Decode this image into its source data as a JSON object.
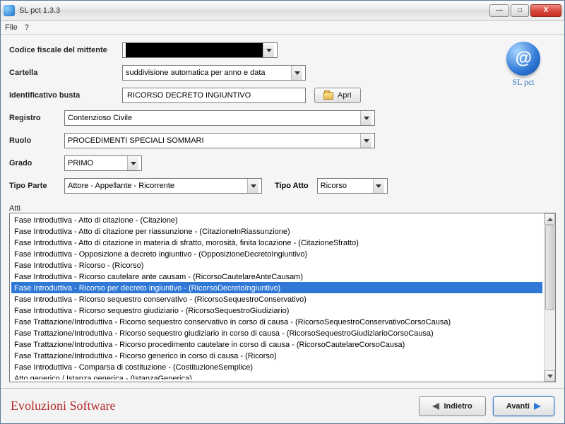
{
  "window": {
    "title": "SL pct 1.3.3"
  },
  "menubar": {
    "file": "File",
    "help": "?"
  },
  "labels": {
    "codice_fiscale": "Codice fiscale del mittente",
    "cartella": "Cartella",
    "identificativo": "Identificativo busta",
    "registro": "Registro",
    "ruolo": "Ruolo",
    "grado": "Grado",
    "tipo_parte": "Tipo Parte",
    "tipo_atto": "Tipo Atto",
    "atti": "Atti"
  },
  "values": {
    "cartella": "suddivisione automatica per anno e data",
    "identificativo": "RICORSO DECRETO INGIUNTIVO",
    "registro": "Contenzioso Civile",
    "ruolo": "PROCEDIMENTI SPECIALI SOMMARI",
    "grado": "PRIMO",
    "tipo_parte": "Attore - Appellante - Ricorrente",
    "tipo_atto": "Ricorso"
  },
  "buttons": {
    "apri": "Apri",
    "indietro": "Indietro",
    "avanti": "Avanti"
  },
  "logo_text": "SL pct",
  "selected_index": 6,
  "atti_list": [
    "Fase Introduttiva - Atto di citazione - (Citazione)",
    "Fase Introduttiva - Atto di citazione per riassunzione - (CitazioneInRiassunzione)",
    "Fase Introduttiva - Atto di citazione in materia di sfratto, morosità, finita locazione - (CitazioneSfratto)",
    "Fase Introduttiva - Opposizione a decreto ingiuntivo - (OpposizioneDecretoIngiuntivo)",
    "Fase Introduttiva - Ricorso - (Ricorso)",
    "Fase Introduttiva - Ricorso cautelare ante causam - (RicorsoCautelareAnteCausam)",
    "Fase Introduttiva - Ricorso per decreto ingiuntivo - (RicorsoDecretoIngiuntivo)",
    "Fase Introduttiva - Ricorso sequestro conservativo - (RicorsoSequestroConservativo)",
    "Fase Introduttiva - Ricorso sequestro giudiziario - (RicorsoSequestroGiudiziario)",
    "Fase Trattazione/Introduttiva - Ricorso sequestro conservativo in corso di causa - (RicorsoSequestroConservativoCorsoCausa)",
    "Fase Trattazione/Introduttiva - Ricorso sequestro giudiziario in corso di causa - (RicorsoSequestroGiudiziarioCorsoCausa)",
    "Fase Trattazione/Introduttiva - Ricorso procedimento cautelare in corso di causa - (RicorsoCautelareCorsoCausa)",
    "Fase Trattazione/Introduttiva - Ricorso generico in corso di causa - (Ricorso)",
    "Fase Introduttiva - Comparsa di costituzione - (CostituzioneSemplice)",
    "Atto generico / Istanza generica - (IstanzaGenerica)"
  ],
  "footer_brand": "Evoluzioni Software"
}
